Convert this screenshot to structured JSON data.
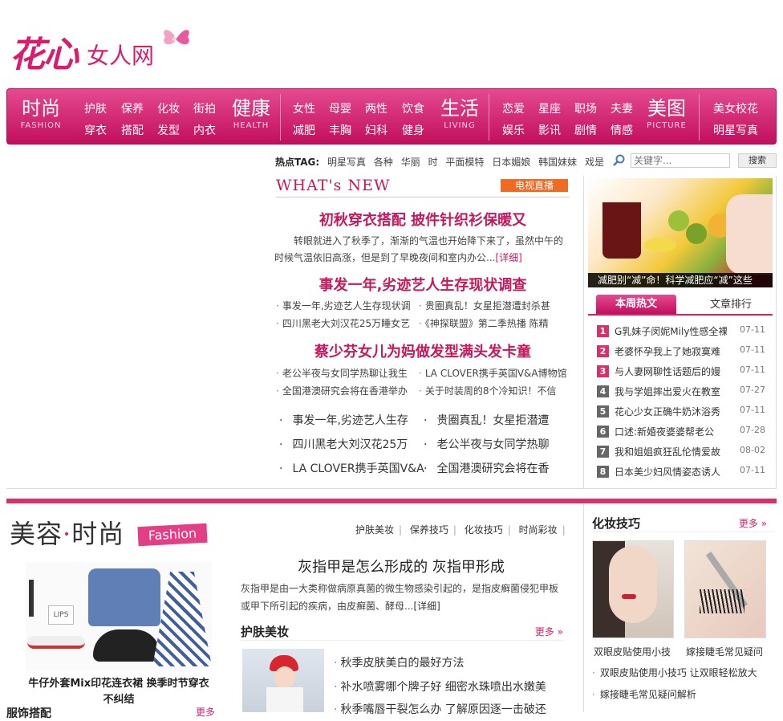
{
  "logo": {
    "main": "花心",
    "sub": "女人网"
  },
  "nav": {
    "groups": [
      {
        "zh": "时尚",
        "en": "FASHION",
        "subs": [
          [
            "护肤",
            "保养",
            "化妆",
            "街拍"
          ],
          [
            "穿衣",
            "搭配",
            "发型",
            "内衣"
          ]
        ]
      },
      {
        "zh": "健康",
        "en": "HEALTH",
        "subs": [
          [
            "女性",
            "母婴",
            "两性",
            "饮食"
          ],
          [
            "减肥",
            "丰胸",
            "妇科",
            "健身"
          ]
        ]
      },
      {
        "zh": "生活",
        "en": "LIVING",
        "subs": [
          [
            "恋爱",
            "星座",
            "职场",
            "夫妻"
          ],
          [
            "娱乐",
            "影讯",
            "剧情",
            "情感"
          ]
        ]
      },
      {
        "zh": "美图",
        "en": "PICTURE",
        "subs": [
          [
            "美女校花"
          ],
          [
            "明星写真"
          ]
        ]
      }
    ]
  },
  "hot": {
    "label": "热点TAG:",
    "tags": [
      "明星写真",
      "各种",
      "华丽",
      "时",
      "平面模特",
      "日本媚娘",
      "韩国妹妹",
      "戏是"
    ]
  },
  "search": {
    "placeholder": "关键字...",
    "button": "搜索"
  },
  "whatsnew": {
    "title": "WHAT's NEW",
    "tv": "电视直播",
    "h1": "初秋穿衣搭配 披件针织衫保暖又",
    "p1": "转眼就进入了秋季了，渐渐的气温也开始降下来了，虽然中午的时候气温依旧高涨，但是到了早晚夜间和室内办公...",
    "more": "[详细]",
    "h2": "事发一年,劣迹艺人生存现状调查",
    "l2": [
      "事发一年,劣迹艺人生存现状调",
      "贵圈真乱！女星拒潜遭封杀甚",
      "四川黑老大刘汉花25万睡女艺",
      "《神探联盟》第二季热播 陈精"
    ],
    "h3": "蔡少芬女儿为妈做发型满头发卡童",
    "l3": [
      "老公半夜与女同学热聊让我生",
      "LA CLOVER携手英国V&A博物馆",
      "全国港澳研究会将在香港举办",
      "关于时装周的8个冷知识！不信"
    ],
    "l4": [
      "事发一年,劣迹艺人生存",
      "贵圈真乱！女星拒潜遭",
      "四川黑老大刘汉花25万",
      "老公半夜与女同学热聊",
      "LA CLOVER携手英国V&A",
      "全国港澳研究会将在香"
    ]
  },
  "right": {
    "caption": "减肥别“减”命！科学减肥应“减”这些",
    "tab_active": "本周热文",
    "tab_other": "文章排行",
    "rank": [
      {
        "n": "1",
        "t": "G乳妹子闵妮Mily性感全裸",
        "d": "07-11",
        "c": "#d8306d"
      },
      {
        "n": "2",
        "t": "老婆怀孕我上了她寂寞难",
        "d": "07-11",
        "c": "#d8306d"
      },
      {
        "n": "3",
        "t": "与人妻网聊性话题后的嫚",
        "d": "07-11",
        "c": "#d8306d"
      },
      {
        "n": "4",
        "t": "我与学姐摔出爱火在教室",
        "d": "07-27",
        "c": "#666666"
      },
      {
        "n": "5",
        "t": "花心少女正确牛奶沐浴秀",
        "d": "07-11",
        "c": "#666666"
      },
      {
        "n": "6",
        "t": "口述:新婚夜婆婆帮老公",
        "d": "07-28",
        "c": "#666666"
      },
      {
        "n": "7",
        "t": "我和姐姐疯狂乱伦情爱故",
        "d": "08-02",
        "c": "#666666"
      },
      {
        "n": "8",
        "t": "日本美少妇风情姿态诱人",
        "d": "07-11",
        "c": "#666666"
      }
    ]
  },
  "beauty": {
    "title1": "美容",
    "dot": "·",
    "title2": "时尚",
    "badge": "Fashion",
    "links": [
      "护肤美妆",
      "保养技巧",
      "化妆技巧",
      "时尚彩妆"
    ],
    "img_label": "LIPS",
    "caption": "牛仔外套Mix印花连衣裙 换季时节穿衣不纠结",
    "headline": "灰指甲是怎么形成的 灰指甲形成",
    "para": "灰指甲是由一大类称做病原真菌的微生物感染引起的，是指皮癣菌侵犯甲板或甲下所引起的疾病，由皮癣菌、酵母...",
    "more": "[详细]",
    "sub_title": "护肤美妆",
    "sub_more": "更多",
    "list": [
      "秋季皮肤美白的最好方法",
      "补水喷雾哪个牌子好 细密水珠喷出水嫩美",
      "秋季嘴唇干裂怎么办 了解原因逐一击破还"
    ],
    "sec3_title": "服饰搭配",
    "sec3_more": "更多"
  },
  "makeup": {
    "title": "化妆技巧",
    "more": "更多",
    "cap1": "双眼皮贴使用小技",
    "cap2": "嫁接睫毛常见疑问",
    "list": [
      "双眼皮贴使用小技巧 让双眼轻松放大",
      "嫁接睫毛常见疑问解析"
    ]
  },
  "colors": {
    "accent": "#d3246f",
    "nav": "#c10f5e"
  }
}
